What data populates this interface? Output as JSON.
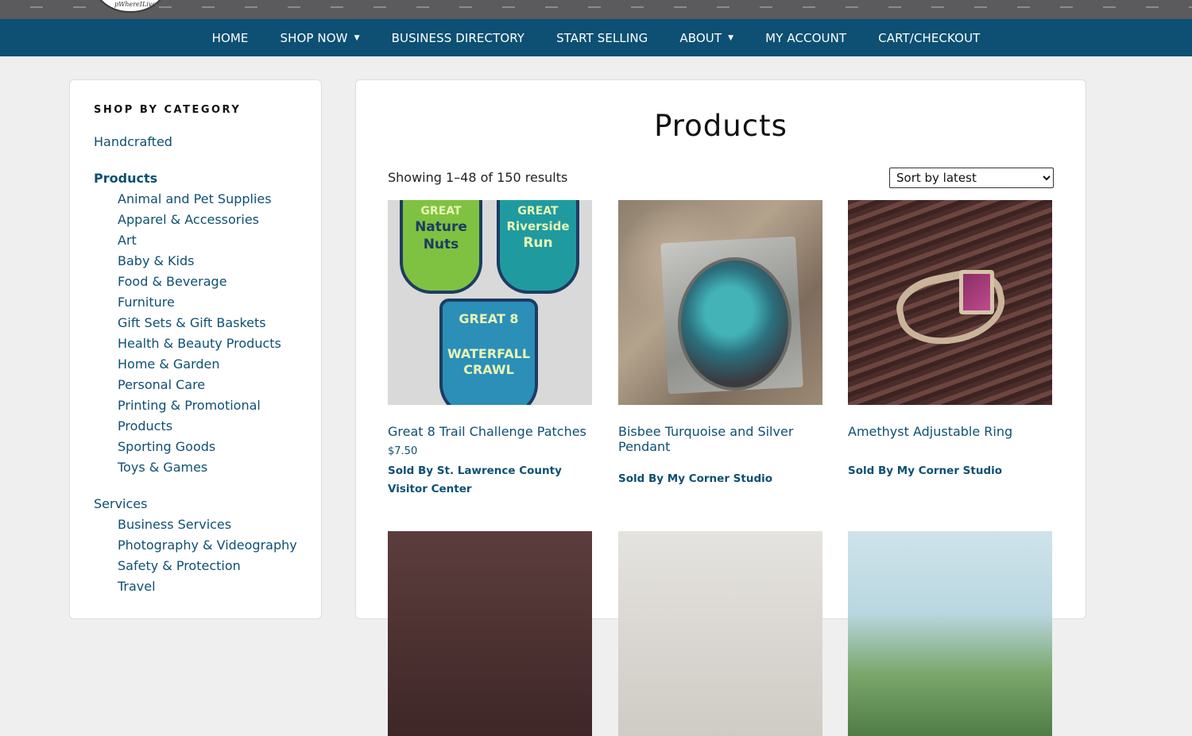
{
  "nav": {
    "items": [
      {
        "label": "HOME",
        "caret": false
      },
      {
        "label": "SHOP NOW",
        "caret": true
      },
      {
        "label": "BUSINESS DIRECTORY",
        "caret": false
      },
      {
        "label": "START SELLING",
        "caret": false
      },
      {
        "label": "ABOUT",
        "caret": true
      },
      {
        "label": "MY ACCOUNT",
        "caret": false
      },
      {
        "label": "CART/CHECKOUT",
        "caret": false
      }
    ],
    "caret_glyph": "▼"
  },
  "logo": {
    "partial_text": "pWhereILive"
  },
  "sidebar": {
    "heading": "SHOP BY CATEGORY",
    "top_categories": {
      "handcrafted": "Handcrafted",
      "products": "Products",
      "services": "Services"
    },
    "product_subcategories": [
      "Animal and Pet Supplies",
      "Apparel & Accessories",
      "Art",
      "Baby & Kids",
      "Food & Beverage",
      "Furniture",
      "Gift Sets & Gift Baskets",
      "Health & Beauty Products",
      "Home & Garden",
      "Personal Care",
      "Printing & Promotional",
      "Products",
      "Sporting Goods",
      "Toys & Games"
    ],
    "service_subcategories": [
      "Business Services",
      "Photography & Videography",
      "Safety & Protection",
      "Travel"
    ]
  },
  "main": {
    "title": "Products",
    "result_count": "Showing 1–48 of 150 results",
    "sort": {
      "selected": "Sort by latest"
    },
    "patch_texts": [
      {
        "line1": "GREAT",
        "line2": "Nature",
        "line3": "Nuts"
      },
      {
        "line1": "GREAT",
        "line2": "Riverside",
        "line3": "Run"
      },
      {
        "line1": "GREAT 8",
        "line2": "WATERFALL",
        "line3": "CRAWL"
      }
    ],
    "products": [
      {
        "name": "Great 8 Trail Challenge Patches",
        "price": "$7.50",
        "seller": "Sold By St. Lawrence County Visitor Center"
      },
      {
        "name": "Bisbee Turquoise and Silver Pendant",
        "price": "",
        "seller": "Sold By My Corner Studio"
      },
      {
        "name": "Amethyst Adjustable Ring",
        "price": "",
        "seller": "Sold By My Corner Studio"
      }
    ]
  },
  "colors": {
    "nav_bg": "#0d5073",
    "link": "#0d5073",
    "page_bg": "#efefef"
  }
}
